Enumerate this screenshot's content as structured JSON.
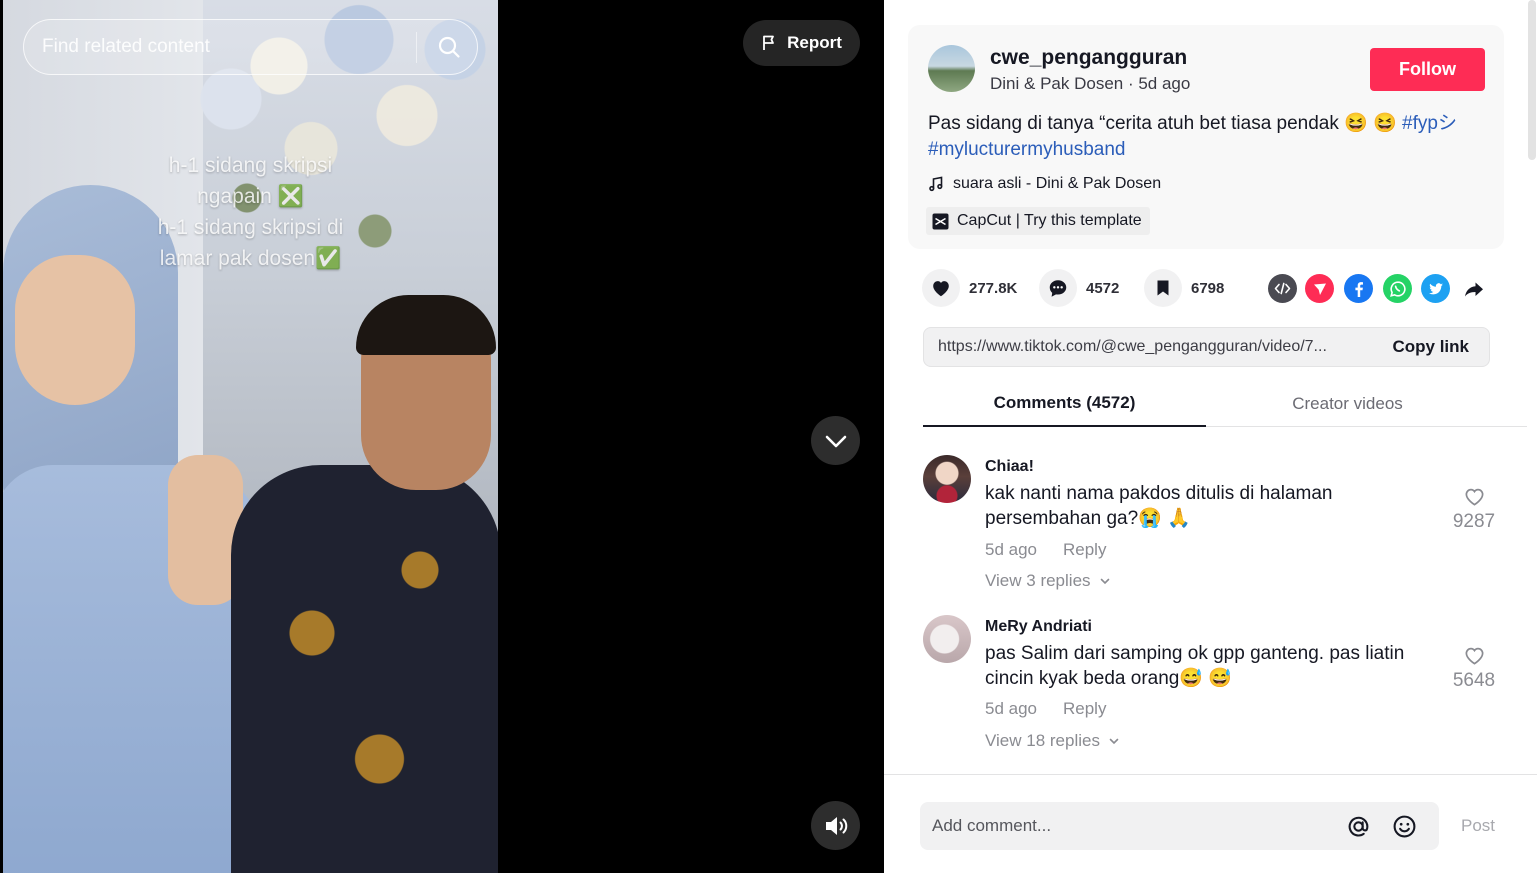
{
  "video": {
    "search_placeholder": "Find related content",
    "report_label": "Report",
    "overlay_lines": [
      "h-1 sidang skripsi",
      "ngapain ❎",
      "h-1 sidang skripsi di",
      "lamar pak dosen✅"
    ]
  },
  "post": {
    "username": "cwe_pengangguran",
    "display_name": "Dini & Pak Dosen",
    "separator": " · ",
    "age": "5d ago",
    "follow_label": "Follow",
    "caption_text": "Pas sidang di tanya “cerita atuh bet tiasa pendak 😆 😆 ",
    "hashtags": [
      "#fypシ",
      "#mylucturermyhusband"
    ],
    "music": "suara asli - Dini & Pak Dosen",
    "template_label": "CapCut | Try this template"
  },
  "stats": {
    "likes": "277.8K",
    "comments": "4572",
    "saves": "6798"
  },
  "share_icons": [
    "embed-icon",
    "send-to-friends-icon",
    "facebook-icon",
    "whatsapp-icon",
    "twitter-icon",
    "share-arrow-icon"
  ],
  "colors": {
    "accent": "#fe2c55",
    "hashtag": "#2b5db9",
    "facebook": "#1877f2",
    "whatsapp": "#25d366",
    "twitter": "#1da1f2"
  },
  "link": {
    "url": "https://www.tiktok.com/@cwe_pengangguran/video/7...",
    "copy_label": "Copy link"
  },
  "tabs": [
    {
      "label": "Comments (4572)",
      "active": true
    },
    {
      "label": "Creator videos",
      "active": false
    }
  ],
  "comments": [
    {
      "name": "Chiaa!",
      "text": "kak nanti nama pakdos ditulis di halaman persembahan ga?😭 🙏",
      "age": "5d ago",
      "reply_label": "Reply",
      "replies_label": "View 3 replies",
      "likes": "9287"
    },
    {
      "name": "MeRy Andriati",
      "text": "pas Salim dari samping ok gpp ganteng. pas liatin cincin kyak beda orang😅 😅",
      "age": "5d ago",
      "reply_label": "Reply",
      "replies_label": "View 18 replies",
      "likes": "5648"
    }
  ],
  "composer": {
    "placeholder": "Add comment...",
    "post_label": "Post"
  }
}
